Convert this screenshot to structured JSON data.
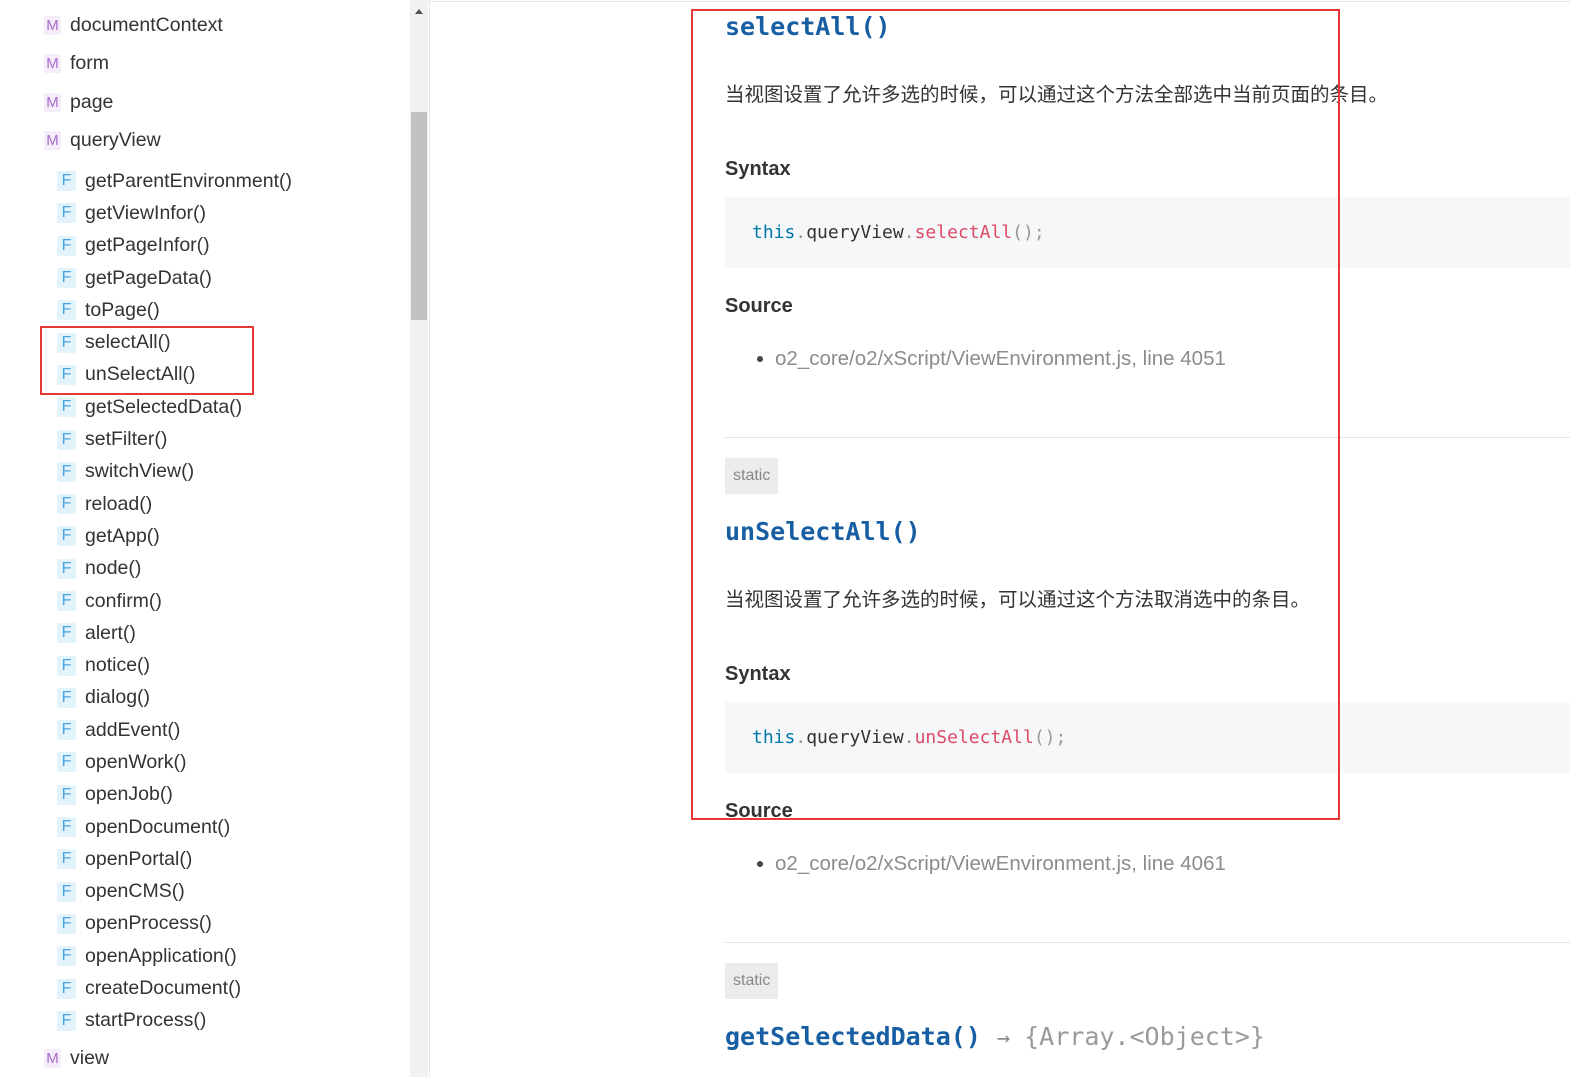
{
  "theme": {
    "title_color": "#175ea3",
    "text_color": "#333333",
    "muted_color": "#8c8c8c",
    "code_background": "#f6f7f8",
    "code_keyword": "#0077aa",
    "code_function": "#dd4a68",
    "code_punctuation": "#999999",
    "highlight_border": "#e53935",
    "module_badge_color": "#a86ccb",
    "module_badge_background": "#f6edfa",
    "function_badge_color": "#4aa3df",
    "function_badge_background": "#e3f3fc"
  },
  "sidebar": {
    "items": [
      {
        "kind": "M",
        "label": "documentContext"
      },
      {
        "kind": "M",
        "label": "form"
      },
      {
        "kind": "M",
        "label": "page"
      },
      {
        "kind": "M",
        "label": "queryView",
        "members": [
          {
            "kind": "F",
            "label": "getParentEnvironment()"
          },
          {
            "kind": "F",
            "label": "getViewInfor()"
          },
          {
            "kind": "F",
            "label": "getPageInfor()"
          },
          {
            "kind": "F",
            "label": "getPageData()"
          },
          {
            "kind": "F",
            "label": "toPage()"
          },
          {
            "kind": "F",
            "label": "selectAll()"
          },
          {
            "kind": "F",
            "label": "unSelectAll()"
          },
          {
            "kind": "F",
            "label": "getSelectedData()"
          },
          {
            "kind": "F",
            "label": "setFilter()"
          },
          {
            "kind": "F",
            "label": "switchView()"
          },
          {
            "kind": "F",
            "label": "reload()"
          },
          {
            "kind": "F",
            "label": "getApp()"
          },
          {
            "kind": "F",
            "label": "node()"
          },
          {
            "kind": "F",
            "label": "confirm()"
          },
          {
            "kind": "F",
            "label": "alert()"
          },
          {
            "kind": "F",
            "label": "notice()"
          },
          {
            "kind": "F",
            "label": "dialog()"
          },
          {
            "kind": "F",
            "label": "addEvent()"
          },
          {
            "kind": "F",
            "label": "openWork()"
          },
          {
            "kind": "F",
            "label": "openJob()"
          },
          {
            "kind": "F",
            "label": "openDocument()"
          },
          {
            "kind": "F",
            "label": "openPortal()"
          },
          {
            "kind": "F",
            "label": "openCMS()"
          },
          {
            "kind": "F",
            "label": "openProcess()"
          },
          {
            "kind": "F",
            "label": "openApplication()"
          },
          {
            "kind": "F",
            "label": "createDocument()"
          },
          {
            "kind": "F",
            "label": "startProcess()"
          }
        ]
      },
      {
        "kind": "M",
        "label": "view"
      }
    ]
  },
  "main": {
    "sections": [
      {
        "title": "selectAll()",
        "description": "当视图设置了允许多选的时候，可以通过这个方法全部选中当前页面的条目。",
        "syntax_heading": "Syntax",
        "code_tokens": [
          "this",
          ".",
          "queryView",
          ".",
          "selectAll",
          "();"
        ],
        "source_heading": "Source",
        "source_items": [
          "o2_core/o2/xScript/ViewEnvironment.js, line 4051"
        ]
      },
      {
        "badge": "static",
        "title": "unSelectAll()",
        "description": "当视图设置了允许多选的时候，可以通过这个方法取消选中的条目。",
        "syntax_heading": "Syntax",
        "code_tokens": [
          "this",
          ".",
          "queryView",
          ".",
          "unSelectAll",
          "();"
        ],
        "source_heading": "Source",
        "source_items": [
          "o2_core/o2/xScript/ViewEnvironment.js, line 4061"
        ]
      },
      {
        "badge": "static",
        "title": "getSelectedData()",
        "return_arrow": "→",
        "return_type": "{Array.<Object>}"
      }
    ]
  }
}
